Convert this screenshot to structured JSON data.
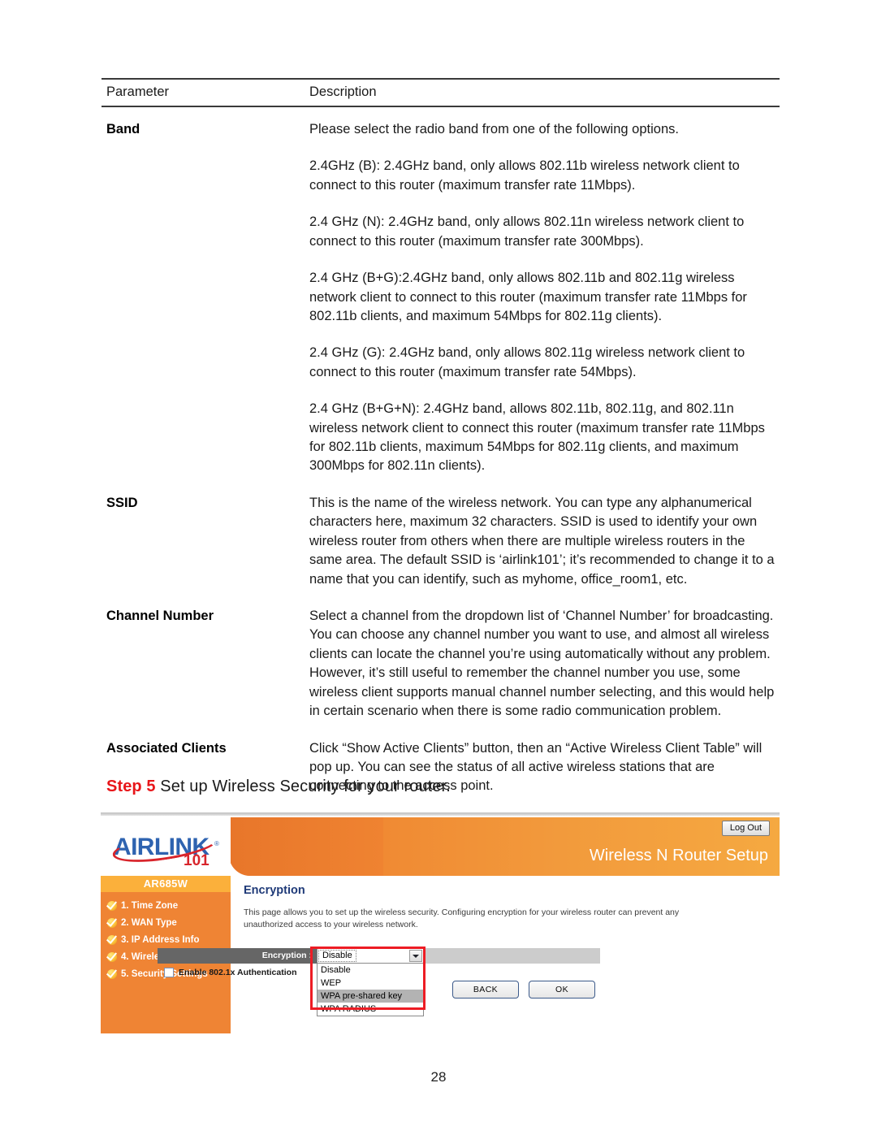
{
  "table": {
    "headers": {
      "parameter": "Parameter",
      "description": "Description"
    },
    "rows": [
      {
        "label": "Band",
        "paragraphs": [
          "Please select the radio band from one of the following options.",
          "2.4GHz (B): 2.4GHz band, only allows 802.11b wireless network client to connect to this router (maximum transfer rate 11Mbps).",
          "2.4 GHz (N): 2.4GHz band, only allows 802.11n wireless network client to connect to this router (maximum transfer rate 300Mbps).",
          "2.4 GHz (B+G):2.4GHz band, only allows 802.11b and 802.11g wireless network client to connect to this router (maximum transfer rate 11Mbps for 802.11b clients, and maximum 54Mbps for 802.11g clients).",
          "2.4 GHz (G): 2.4GHz band, only allows 802.11g wireless network client to connect to this router (maximum transfer rate 54Mbps).",
          "2.4 GHz (B+G+N): 2.4GHz band, allows 802.11b, 802.11g, and 802.11n wireless network client to connect this router (maximum transfer rate 11Mbps for 802.11b clients, maximum 54Mbps for 802.11g clients, and maximum 300Mbps for 802.11n clients)."
        ]
      },
      {
        "label": "SSID",
        "paragraphs": [
          "This is the name of the wireless network. You can type any alphanumerical characters here, maximum 32 characters. SSID is used to identify your own wireless router from others when there are multiple wireless routers in the same area. The default SSID is ‘airlink101’; it’s recommended to change it to a name that you can identify, such as myhome, office_room1, etc."
        ]
      },
      {
        "label": "Channel Number",
        "paragraphs": [
          "Select a channel from the dropdown list of ‘Channel Number’ for broadcasting. You can choose any channel number you want to use, and almost all wireless clients can locate the channel you’re using automatically without any problem. However, it’s still useful to remember the channel number you use, some wireless client supports manual channel number selecting, and this would help in certain scenario when there is some radio communication problem."
        ]
      },
      {
        "label": "Associated Clients",
        "paragraphs": [
          "Click “Show Active Clients” button, then an “Active Wireless Client Table” will pop up. You can see the status of all active wireless stations that are connecting to the access point."
        ]
      }
    ]
  },
  "step": {
    "keyword": "Step 5",
    "text": " Set up Wireless Security for your router."
  },
  "router_ui": {
    "logo": {
      "word_a": "A",
      "word_rest": "IR",
      "word_link": "L",
      "word_ink": "INK",
      "full_text": "AIRLINK",
      "suffix": "101",
      "registered": "®"
    },
    "title": "Wireless N Router Setup",
    "logout_label": "Log Out",
    "sidebar": {
      "model": "AR685W",
      "items": [
        {
          "label": "1. Time Zone"
        },
        {
          "label": "2. WAN Type"
        },
        {
          "label": "3. IP Address Info"
        },
        {
          "label": "4. Wireless Settings"
        },
        {
          "label": "5. Security Settings"
        }
      ]
    },
    "content": {
      "heading": "Encryption",
      "description": "This page allows you to set up the wireless security. Configuring encryption for your wireless router can prevent any unauthorized access to your wireless network."
    },
    "encryption": {
      "field_label": "Encryption :",
      "selected": "Disable",
      "options": [
        {
          "label": "Disable",
          "highlighted": false
        },
        {
          "label": "WEP",
          "highlighted": false
        },
        {
          "label": "WPA pre-shared key",
          "highlighted": true
        },
        {
          "label": "WPA RADIUS",
          "highlighted": false
        }
      ],
      "highlight_color": "#ed1c24"
    },
    "checkbox": {
      "label": "Enable 802.1x Authentication",
      "checked": false
    },
    "buttons": {
      "back": "BACK",
      "ok": "OK"
    }
  },
  "page_number": "28"
}
